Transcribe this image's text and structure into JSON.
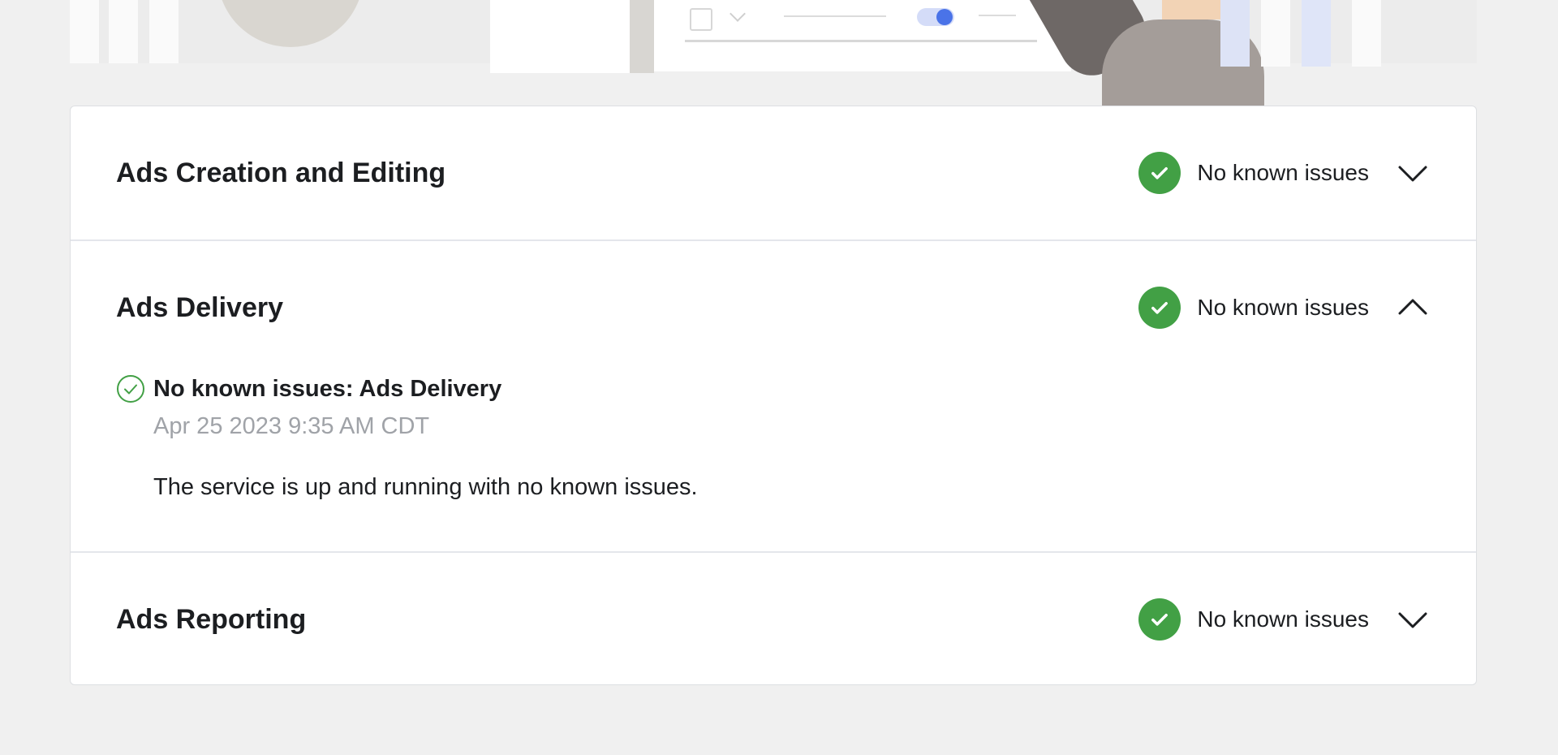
{
  "colors": {
    "status_ok": "#42a045",
    "page_bg": "#f0f0f0",
    "muted_text": "#a0a3a8"
  },
  "illustration": {
    "icon": "status-page-illustration"
  },
  "accordion": {
    "items": [
      {
        "title": "Ads Creation and Editing",
        "status": "No known issues",
        "status_icon": "check-circle-filled-icon",
        "expanded": false,
        "toggle_icon": "chevron-down-icon"
      },
      {
        "title": "Ads Delivery",
        "status": "No known issues",
        "status_icon": "check-circle-filled-icon",
        "expanded": true,
        "toggle_icon": "chevron-up-icon",
        "detail": {
          "icon": "check-circle-outline-icon",
          "title": "No known issues: Ads Delivery",
          "timestamp": "Apr 25 2023 9:35 AM CDT",
          "description": "The service is up and running with no known issues."
        }
      },
      {
        "title": "Ads Reporting",
        "status": "No known issues",
        "status_icon": "check-circle-filled-icon",
        "expanded": false,
        "toggle_icon": "chevron-down-icon"
      }
    ]
  }
}
